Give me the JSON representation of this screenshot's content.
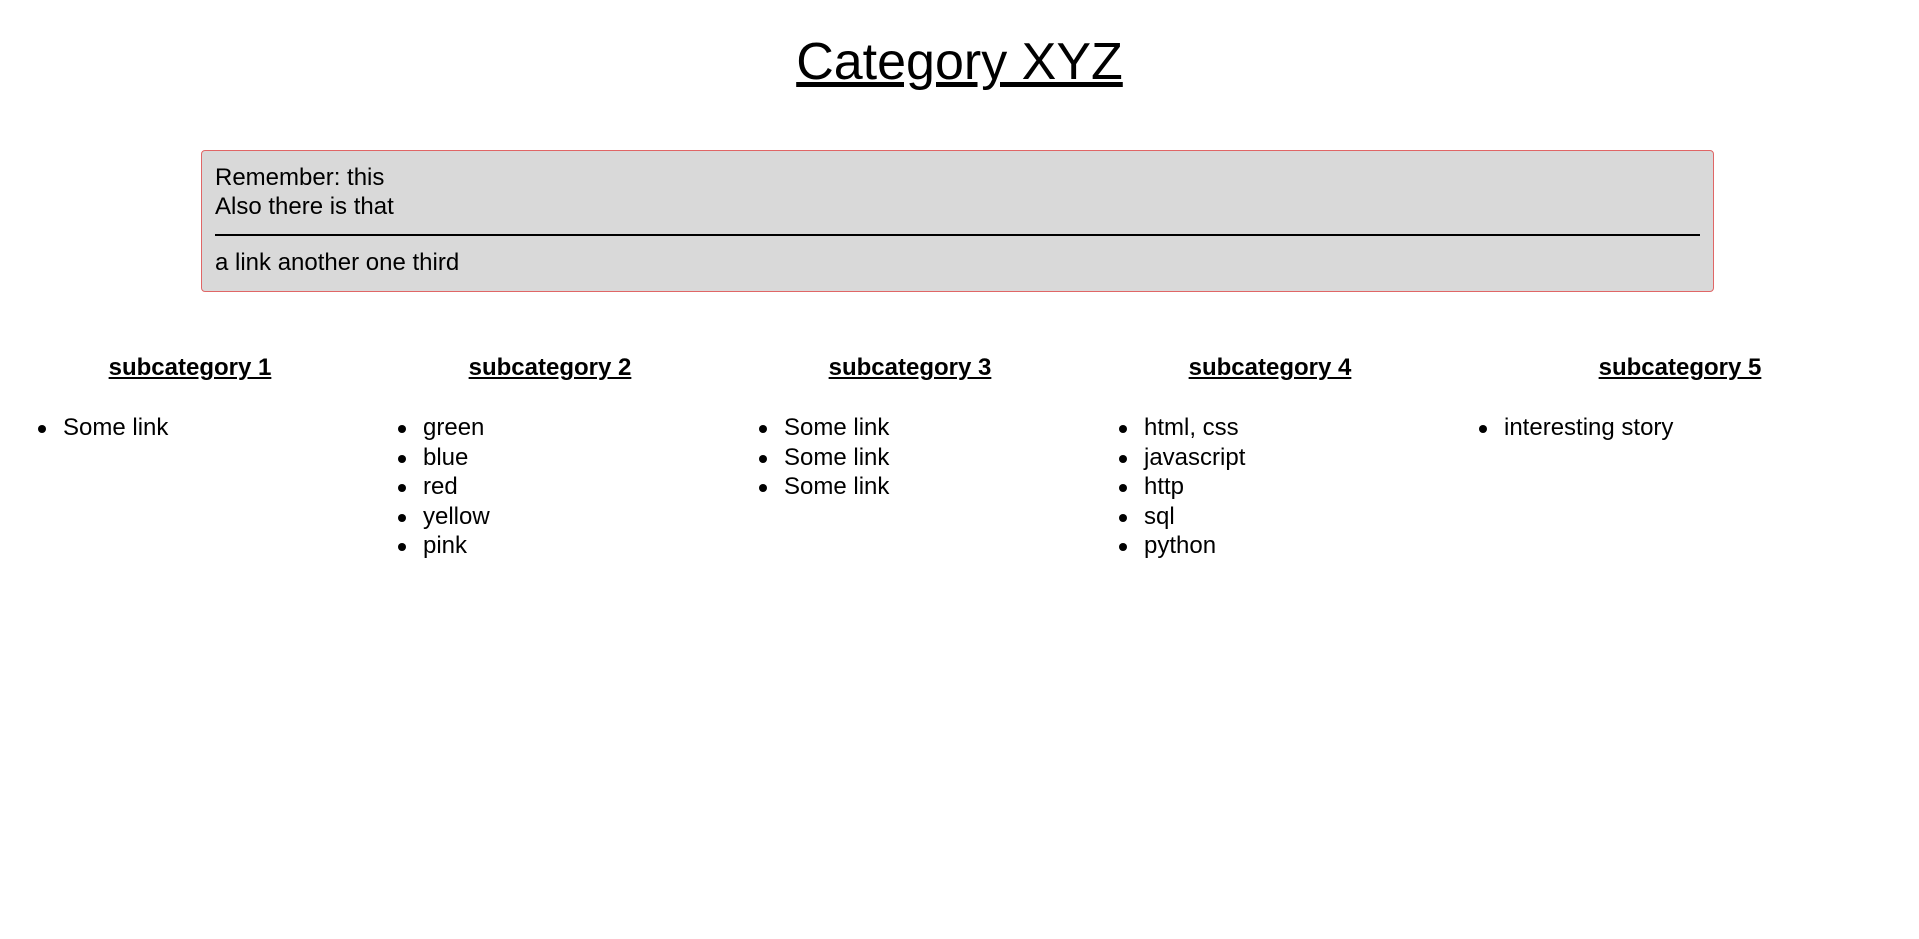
{
  "page": {
    "title": "Category XYZ"
  },
  "notice": {
    "line1": "Remember: this",
    "line2": "Also there is that",
    "links": [
      "a link",
      "another one",
      "third"
    ]
  },
  "subcategories": [
    {
      "title": "subcategory 1",
      "items": [
        "Some link"
      ]
    },
    {
      "title": "subcategory 2",
      "items": [
        "green",
        "blue",
        "red",
        "yellow",
        "pink"
      ]
    },
    {
      "title": "subcategory 3",
      "items": [
        "Some link",
        "Some link",
        "Some link"
      ]
    },
    {
      "title": "subcategory 4",
      "items": [
        "html, css",
        "javascript",
        "http",
        "sql",
        "python"
      ]
    },
    {
      "title": "subcategory 5",
      "items": [
        "interesting story"
      ]
    }
  ],
  "colors": {
    "notice_background": "#d9d9d9",
    "notice_border": "#e06666",
    "text": "#000000"
  }
}
